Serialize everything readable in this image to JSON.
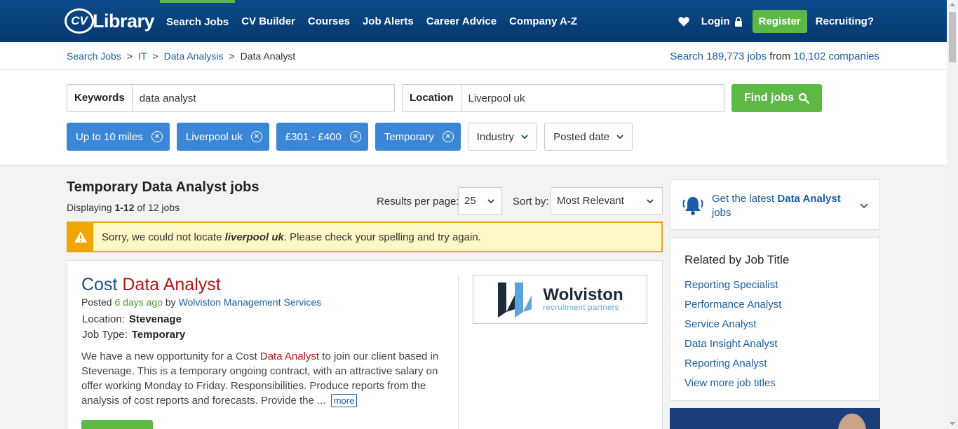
{
  "header": {
    "logo_cv": "CV",
    "logo_text": "Library",
    "nav": [
      "Search Jobs",
      "CV Builder",
      "Courses",
      "Job Alerts",
      "Career Advice",
      "Company A-Z"
    ],
    "login": "Login",
    "register": "Register",
    "recruiting": "Recruiting?"
  },
  "breadcrumb": {
    "items": [
      "Search Jobs",
      "IT",
      "Data Analysis"
    ],
    "current": "Data Analyst",
    "stats_prefix": "Search",
    "stats_jobs": "189,773 jobs",
    "stats_mid": "from",
    "stats_companies": "10,102 companies"
  },
  "search": {
    "keywords_label": "Keywords",
    "keywords_value": "data analyst",
    "location_label": "Location",
    "location_value": "Liverpool uk",
    "find_button": "Find jobs",
    "filters": [
      "Up to 10 miles",
      "Liverpool uk",
      "£301 - £400",
      "Temporary"
    ],
    "dropdowns": [
      "Industry",
      "Posted date"
    ]
  },
  "results": {
    "title": "Temporary Data Analyst jobs",
    "displaying_prefix": "Displaying",
    "displaying_range": "1-12",
    "displaying_suffix": "of 12 jobs",
    "per_page_label": "Results per page:",
    "per_page_value": "25",
    "sort_label": "Sort by:",
    "sort_value": "Most Relevant",
    "warning_pre": "Sorry, we could not locate",
    "warning_term": "liverpool uk",
    "warning_post": ". Please check your spelling and try again."
  },
  "job": {
    "title_part1": "Cost",
    "title_part2": "Data Analyst",
    "posted_prefix": "Posted",
    "posted_ago": "6 days ago",
    "posted_by": "by",
    "company": "Wolviston Management Services",
    "location_label": "Location:",
    "location_value": "Stevenage",
    "type_label": "Job Type:",
    "type_value": "Temporary",
    "desc_pre": "We have a new opportunity for a Cost",
    "desc_hl": "Data Analyst",
    "desc_post": "to join our client based in Stevenage. This is a temporary ongoing contract, with an attractive salary on offer working Monday to Friday. Responsibilities. Produce reports from the analysis of cost reports and forecasts. Provide the ...",
    "more": "more",
    "logo_name": "Wolviston",
    "logo_sub": "recruitment partners"
  },
  "sidebar": {
    "alert_pre": "Get the latest",
    "alert_bold": "Data Analyst",
    "alert_post": "jobs",
    "related_title": "Related by Job Title",
    "related": [
      "Reporting Specialist",
      "Performance Analyst",
      "Service Analyst",
      "Data Insight Analyst",
      "Reporting Analyst",
      "View more job titles"
    ]
  },
  "colors": {
    "header": "#0b4a8a",
    "accent_green": "#5cb946",
    "chip_blue": "#3b86d6",
    "link": "#1b5ea4",
    "highlight_red": "#b01818",
    "warning_border": "#f0a500"
  }
}
